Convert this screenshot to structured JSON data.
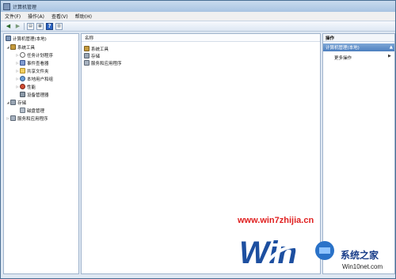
{
  "window": {
    "title": "计算机管理"
  },
  "menu": [
    "文件(F)",
    "操作(A)",
    "查看(V)",
    "帮助(H)"
  ],
  "toolbar": {
    "icons": [
      "back-arrow-icon",
      "forward-arrow-icon",
      "console-tree-icon",
      "properties-icon",
      "help-icon",
      "show-hide-pane-icon"
    ],
    "help_glyph": "?"
  },
  "tree": {
    "root": "计算机管理(本地)",
    "system_tools": "系统工具",
    "task_scheduler": "任务计划程序",
    "event_viewer": "事件查看器",
    "shared_folders": "共享文件夹",
    "local_users": "本地用户和组",
    "performance": "性能",
    "device_manager": "设备管理器",
    "storage": "存储",
    "disk_management": "磁盘管理",
    "services_apps": "服务和应用程序"
  },
  "list": {
    "column_name": "名称",
    "items": [
      "系统工具",
      "存储",
      "服务和应用程序"
    ]
  },
  "actions": {
    "header": "操作",
    "section": "计算机管理(本地)",
    "more": "更多操作"
  },
  "watermark": {
    "url": "www.win7zhijia.cn",
    "cn": "系统之家",
    "site": "Win10net.com"
  }
}
